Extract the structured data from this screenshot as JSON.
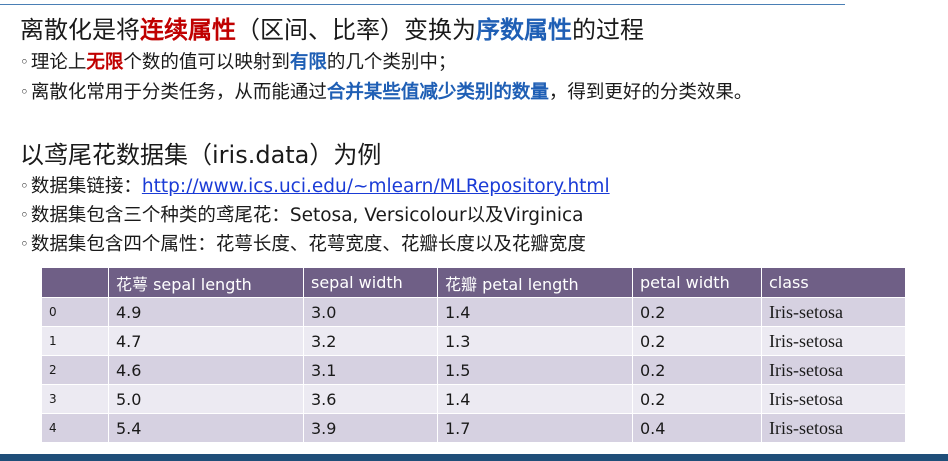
{
  "heading1": {
    "segments": [
      {
        "text": "离散化是将",
        "style": "plain"
      },
      {
        "text": "连续属性",
        "style": "red"
      },
      {
        "text": "（区间、比率）变换为",
        "style": "plain"
      },
      {
        "text": "序数属性",
        "style": "blue"
      },
      {
        "text": "的过程",
        "style": "plain"
      }
    ]
  },
  "bullet_symbol": "◦",
  "bullet1": {
    "segments": [
      {
        "text": "理论上",
        "style": "plain"
      },
      {
        "text": "无限",
        "style": "red"
      },
      {
        "text": "个数的值可以映射到",
        "style": "plain"
      },
      {
        "text": "有限",
        "style": "blue"
      },
      {
        "text": "的几个类别中；",
        "style": "plain"
      }
    ]
  },
  "bullet2": {
    "segments": [
      {
        "text": "离散化常用于分类任务，从而能通过",
        "style": "plain"
      },
      {
        "text": "合并某些值减少类别的数量",
        "style": "blue"
      },
      {
        "text": "，得到更好的分类效果。",
        "style": "plain"
      }
    ]
  },
  "heading2": {
    "segments": [
      {
        "text": "以鸢尾花数据集（iris.data）为例",
        "style": "plain"
      }
    ]
  },
  "bullet3": {
    "segments": [
      {
        "text": "数据集链接：",
        "style": "plain"
      },
      {
        "text": "http://www.ics.uci.edu/~mlearn/MLRepository.html",
        "style": "link"
      }
    ]
  },
  "bullet4": {
    "segments": [
      {
        "text": "数据集包含三个种类的鸢尾花：Setosa, Versicolour以及Virginica",
        "style": "plain"
      }
    ]
  },
  "bullet5": {
    "segments": [
      {
        "text": "数据集包含四个属性：花萼长度、花萼宽度、花瓣长度以及花瓣宽度",
        "style": "plain"
      }
    ]
  },
  "table": {
    "columns": [
      "",
      "花萼 sepal length",
      "sepal width",
      "花瓣 petal length",
      "petal width",
      "class"
    ],
    "rows": [
      [
        "0",
        "4.9",
        "3.0",
        "1.4",
        "0.2",
        "Iris-setosa"
      ],
      [
        "1",
        "4.7",
        "3.2",
        "1.3",
        "0.2",
        "Iris-setosa"
      ],
      [
        "2",
        "4.6",
        "3.1",
        "1.5",
        "0.2",
        "Iris-setosa"
      ],
      [
        "3",
        "5.0",
        "3.6",
        "1.4",
        "0.2",
        "Iris-setosa"
      ],
      [
        "4",
        "5.4",
        "3.9",
        "1.7",
        "0.4",
        "Iris-setosa"
      ]
    ]
  },
  "colors": {
    "emphasis_red": "#c00000",
    "emphasis_blue": "#1f5fb5",
    "link": "#1a3bd6",
    "table_header": "#6f5f86",
    "table_row_odd": "#d6d1e1",
    "table_row_even": "#eceaf2",
    "bottom_bar": "#1f4e79"
  }
}
